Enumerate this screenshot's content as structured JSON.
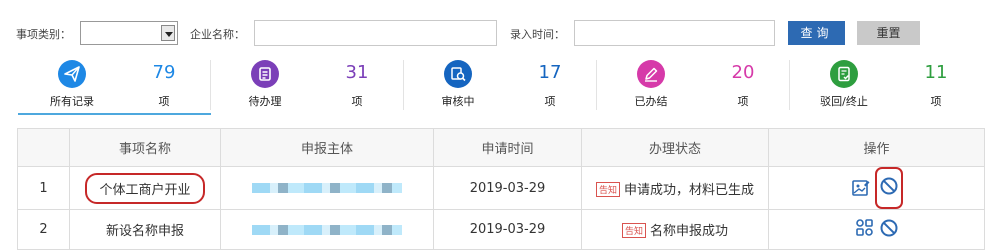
{
  "filter": {
    "type_label": "事项类别：",
    "type_value": "",
    "company_label": "企业名称：",
    "company_value": "",
    "time_label": "录入时间：",
    "time_value": "",
    "query_label": "查询",
    "reset_label": "重置"
  },
  "tabs": [
    {
      "label": "所有记录",
      "count": "79",
      "unit": "项",
      "color": "#1e88e5",
      "icon": "paper-plane-icon",
      "active": true
    },
    {
      "label": "待办理",
      "count": "31",
      "unit": "项",
      "color": "#7b3fb8",
      "icon": "clipboard-icon",
      "active": false
    },
    {
      "label": "审核中",
      "count": "17",
      "unit": "项",
      "color": "#1565c0",
      "icon": "review-icon",
      "active": false
    },
    {
      "label": "已办结",
      "count": "20",
      "unit": "项",
      "color": "#d63aa9",
      "icon": "pen-icon",
      "active": false
    },
    {
      "label": "驳回/终止",
      "count": "11",
      "unit": "项",
      "color": "#2e9e3f",
      "icon": "document-check-icon",
      "active": false
    }
  ],
  "table": {
    "headers": [
      "",
      "事项名称",
      "申报主体",
      "申请时间",
      "办理状态",
      "操作"
    ],
    "rows": [
      {
        "index": "1",
        "name": "个体工商户开业",
        "time": "2019-03-29",
        "badge": "告知",
        "status": "申请成功，材料已生成"
      },
      {
        "index": "2",
        "name": "新设名称申报",
        "time": "2019-03-29",
        "badge": "告知",
        "status": "名称申报成功"
      }
    ]
  },
  "colors": {
    "accent": "#2d6ab3",
    "highlight": "#c62828",
    "badge": "#d9534f"
  }
}
